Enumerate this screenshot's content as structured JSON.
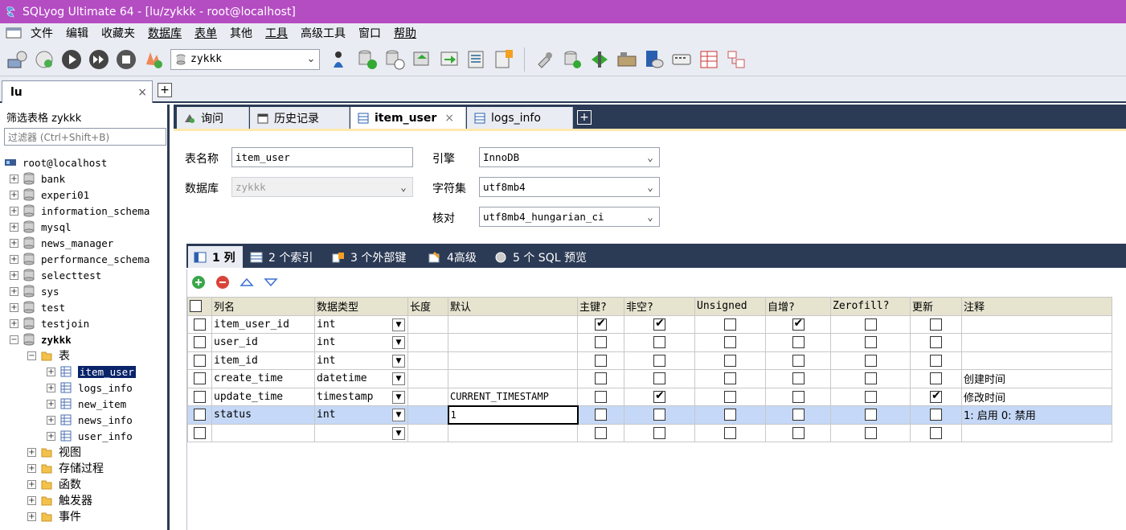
{
  "window": {
    "title": "SQLyog Ultimate 64 - [lu/zykkk - root@localhost]"
  },
  "menu": [
    "文件",
    "编辑",
    "收藏夹",
    "数据库",
    "表单",
    "其他",
    "工具",
    "高级工具",
    "窗口",
    "帮助"
  ],
  "toolbar": {
    "database_select": "zykkk"
  },
  "connection_tab": {
    "label": "lu",
    "close": "×",
    "add": "+"
  },
  "left": {
    "filter_title": "筛选表格 zykkk",
    "filter_placeholder": "过滤器 (Ctrl+Shift+B)",
    "tree": [
      {
        "label": "root@localhost",
        "level": 0,
        "kind": "server"
      },
      {
        "label": "bank",
        "level": 1,
        "kind": "db",
        "toggle": "+"
      },
      {
        "label": "experi01",
        "level": 1,
        "kind": "db",
        "toggle": "+"
      },
      {
        "label": "information_schema",
        "level": 1,
        "kind": "db",
        "toggle": "+"
      },
      {
        "label": "mysql",
        "level": 1,
        "kind": "db",
        "toggle": "+"
      },
      {
        "label": "news_manager",
        "level": 1,
        "kind": "db",
        "toggle": "+"
      },
      {
        "label": "performance_schema",
        "level": 1,
        "kind": "db",
        "toggle": "+"
      },
      {
        "label": "selecttest",
        "level": 1,
        "kind": "db",
        "toggle": "+"
      },
      {
        "label": "sys",
        "level": 1,
        "kind": "db",
        "toggle": "+"
      },
      {
        "label": "test",
        "level": 1,
        "kind": "db",
        "toggle": "+"
      },
      {
        "label": "testjoin",
        "level": 1,
        "kind": "db",
        "toggle": "+"
      },
      {
        "label": "zykkk",
        "level": 1,
        "kind": "db",
        "toggle": "−",
        "bold": true
      },
      {
        "label": "表",
        "level": 2,
        "kind": "folder",
        "toggle": "−"
      },
      {
        "label": "item_user",
        "level": 3,
        "kind": "table",
        "toggle": "+",
        "selected": true
      },
      {
        "label": "logs_info",
        "level": 3,
        "kind": "table",
        "toggle": "+"
      },
      {
        "label": "new_item",
        "level": 3,
        "kind": "table",
        "toggle": "+"
      },
      {
        "label": "news_info",
        "level": 3,
        "kind": "table",
        "toggle": "+"
      },
      {
        "label": "user_info",
        "level": 3,
        "kind": "table",
        "toggle": "+"
      },
      {
        "label": "视图",
        "level": 2,
        "kind": "folder",
        "toggle": "+"
      },
      {
        "label": "存储过程",
        "level": 2,
        "kind": "folder",
        "toggle": "+"
      },
      {
        "label": "函数",
        "level": 2,
        "kind": "folder",
        "toggle": "+"
      },
      {
        "label": "触发器",
        "level": 2,
        "kind": "folder",
        "toggle": "+"
      },
      {
        "label": "事件",
        "level": 2,
        "kind": "folder",
        "toggle": "+"
      }
    ]
  },
  "doc_tabs": [
    {
      "label": "询问"
    },
    {
      "label": "历史记录"
    },
    {
      "label": "item_user",
      "close": "×",
      "active": true
    },
    {
      "label": "logs_info"
    }
  ],
  "doc_tab_add": "+",
  "form": {
    "table_name_label": "表名称",
    "table_name": "item_user",
    "database_label": "数据库",
    "database": "zykkk",
    "engine_label": "引擎",
    "engine": "InnoDB",
    "charset_label": "字符集",
    "charset": "utf8mb4",
    "collation_label": "核对",
    "collation": "utf8mb4_hungarian_ci"
  },
  "sub_tabs": [
    {
      "label": "1 列",
      "active": true
    },
    {
      "label": "2 个索引"
    },
    {
      "label": "3 个外部键"
    },
    {
      "label": "4高级"
    },
    {
      "label": "5 个 SQL 预览"
    }
  ],
  "grid": {
    "headers": [
      "列名",
      "数据类型",
      "长度",
      "默认",
      "主键?",
      "非空?",
      "Unsigned",
      "自增?",
      "Zerofill?",
      "更新",
      "注释"
    ],
    "rows": [
      {
        "name": "item_user_id",
        "type": "int",
        "length": "",
        "default": "",
        "pk": true,
        "nn": true,
        "unsigned": false,
        "ai": true,
        "zf": false,
        "upd": false,
        "comment": ""
      },
      {
        "name": "user_id",
        "type": "int",
        "length": "",
        "default": "",
        "pk": false,
        "nn": false,
        "unsigned": false,
        "ai": false,
        "zf": false,
        "upd": false,
        "comment": ""
      },
      {
        "name": "item_id",
        "type": "int",
        "length": "",
        "default": "",
        "pk": false,
        "nn": false,
        "unsigned": false,
        "ai": false,
        "zf": false,
        "upd": false,
        "comment": ""
      },
      {
        "name": "create_time",
        "type": "datetime",
        "length": "",
        "default": "",
        "pk": false,
        "nn": false,
        "unsigned": false,
        "ai": false,
        "zf": false,
        "upd": false,
        "comment": "创建时间"
      },
      {
        "name": "update_time",
        "type": "timestamp",
        "length": "",
        "default": "CURRENT_TIMESTAMP",
        "pk": false,
        "nn": true,
        "unsigned": false,
        "ai": false,
        "zf": false,
        "upd": true,
        "comment": "修改时间"
      },
      {
        "name": "status",
        "type": "int",
        "length": "",
        "default": "1",
        "pk": false,
        "nn": false,
        "unsigned": false,
        "ai": false,
        "zf": false,
        "upd": false,
        "comment": "1: 启用 0: 禁用",
        "selected": true
      },
      {
        "name": "",
        "type": "",
        "length": "",
        "default": "",
        "pk": false,
        "nn": false,
        "unsigned": false,
        "ai": false,
        "zf": false,
        "upd": false,
        "comment": ""
      }
    ]
  },
  "colors": {
    "titlebar": "#b44cc2",
    "dark_tabstrip": "#2b3a55",
    "selected_row": "#c5d8f7",
    "grid_header": "#e6e3cf"
  }
}
